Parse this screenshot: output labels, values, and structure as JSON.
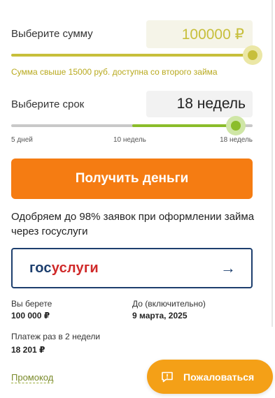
{
  "amount": {
    "label": "Выберите сумму",
    "value": "100000 ₽",
    "slider_fraction": 1.0,
    "hint": "Сумма свыше 15000 руб. доступна со второго займа"
  },
  "term": {
    "label": "Выберите срок",
    "value": "18 недель",
    "slider_fraction": 0.94,
    "ticks": [
      "5 дней",
      "10 недель",
      "18 недель"
    ]
  },
  "cta": {
    "label": "Получить деньги"
  },
  "gosuslugi": {
    "promo_text": "Одобряем до 98% заявок при оформлении займа через госуслуги",
    "logo_part1": "гос",
    "logo_part2": "услуги",
    "arrow": "→"
  },
  "summary": {
    "take_label": "Вы берете",
    "take_value": "100 000 ₽",
    "until_label": "До (включительно)",
    "until_value": "9 марта, 2025",
    "payment_label": "Платеж раз в 2 недели",
    "payment_value": "18 201 ₽"
  },
  "promo_link": "Промокод",
  "complain_button": {
    "label": "Пожаловаться",
    "icon": "message-alert-icon"
  },
  "colors": {
    "amount_accent": "#c7bf3b",
    "term_accent": "#8bbd2a",
    "cta": "#f57c12",
    "complain": "#f4a017",
    "gos_blue": "#1d3f6e",
    "gos_red": "#d02a2a"
  }
}
